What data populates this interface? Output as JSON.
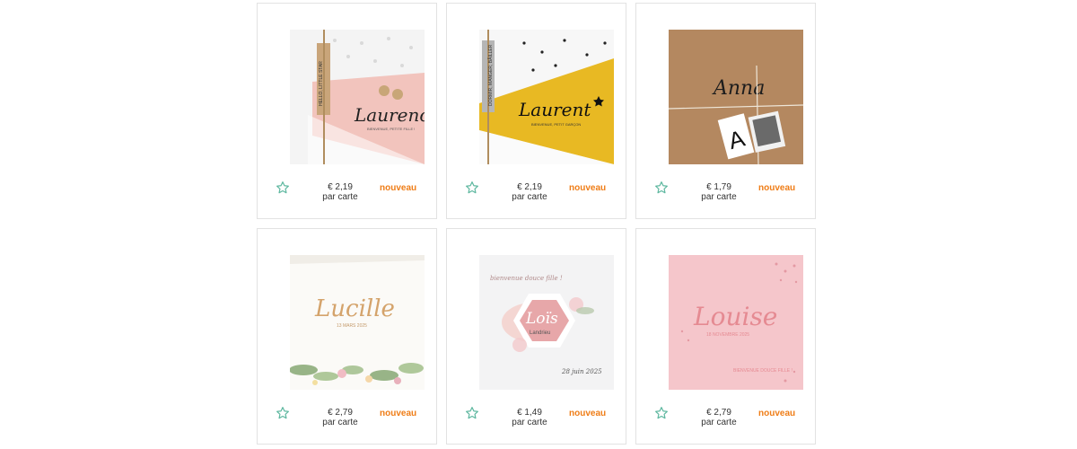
{
  "products": [
    {
      "name_on_card": "Laurence",
      "subtitle": "BIENVENUE, PETITE FILLE !",
      "tag_text": "HELLO, LITTLE STAR",
      "price": "€ 2,19",
      "unit": "par carte",
      "badge": "nouveau"
    },
    {
      "name_on_card": "Laurent",
      "subtitle": "BIENVENUE, PETIT GARÇON",
      "tag_text": "DORMIR, MANGER, BÂILLER",
      "price": "€ 2,19",
      "unit": "par carte",
      "badge": "nouveau"
    },
    {
      "name_on_card": "Anna",
      "subtitle": "",
      "tag_text": "",
      "price": "€ 1,79",
      "unit": "par carte",
      "badge": "nouveau"
    },
    {
      "name_on_card": "Lucille",
      "subtitle": "13 MARS 2025",
      "tag_text": "",
      "price": "€ 2,79",
      "unit": "par carte",
      "badge": "nouveau"
    },
    {
      "name_on_card": "Loïs",
      "subtitle": "Landrieu",
      "greeting": "bienvenue douce fille !",
      "date": "28 juin 2025",
      "price": "€ 1,49",
      "unit": "par carte",
      "badge": "nouveau"
    },
    {
      "name_on_card": "Louise",
      "subtitle": "18 NOVEMBRE 2025",
      "greeting": "BIENVENUE DOUCE FILLE !",
      "price": "€ 2,79",
      "unit": "par carte",
      "badge": "nouveau"
    }
  ],
  "colors": {
    "badge": "#ef7d17",
    "star": "#5fb8a0",
    "card_border": "#e2e2e2"
  },
  "icons": {
    "favorite": "star-outline-icon"
  }
}
